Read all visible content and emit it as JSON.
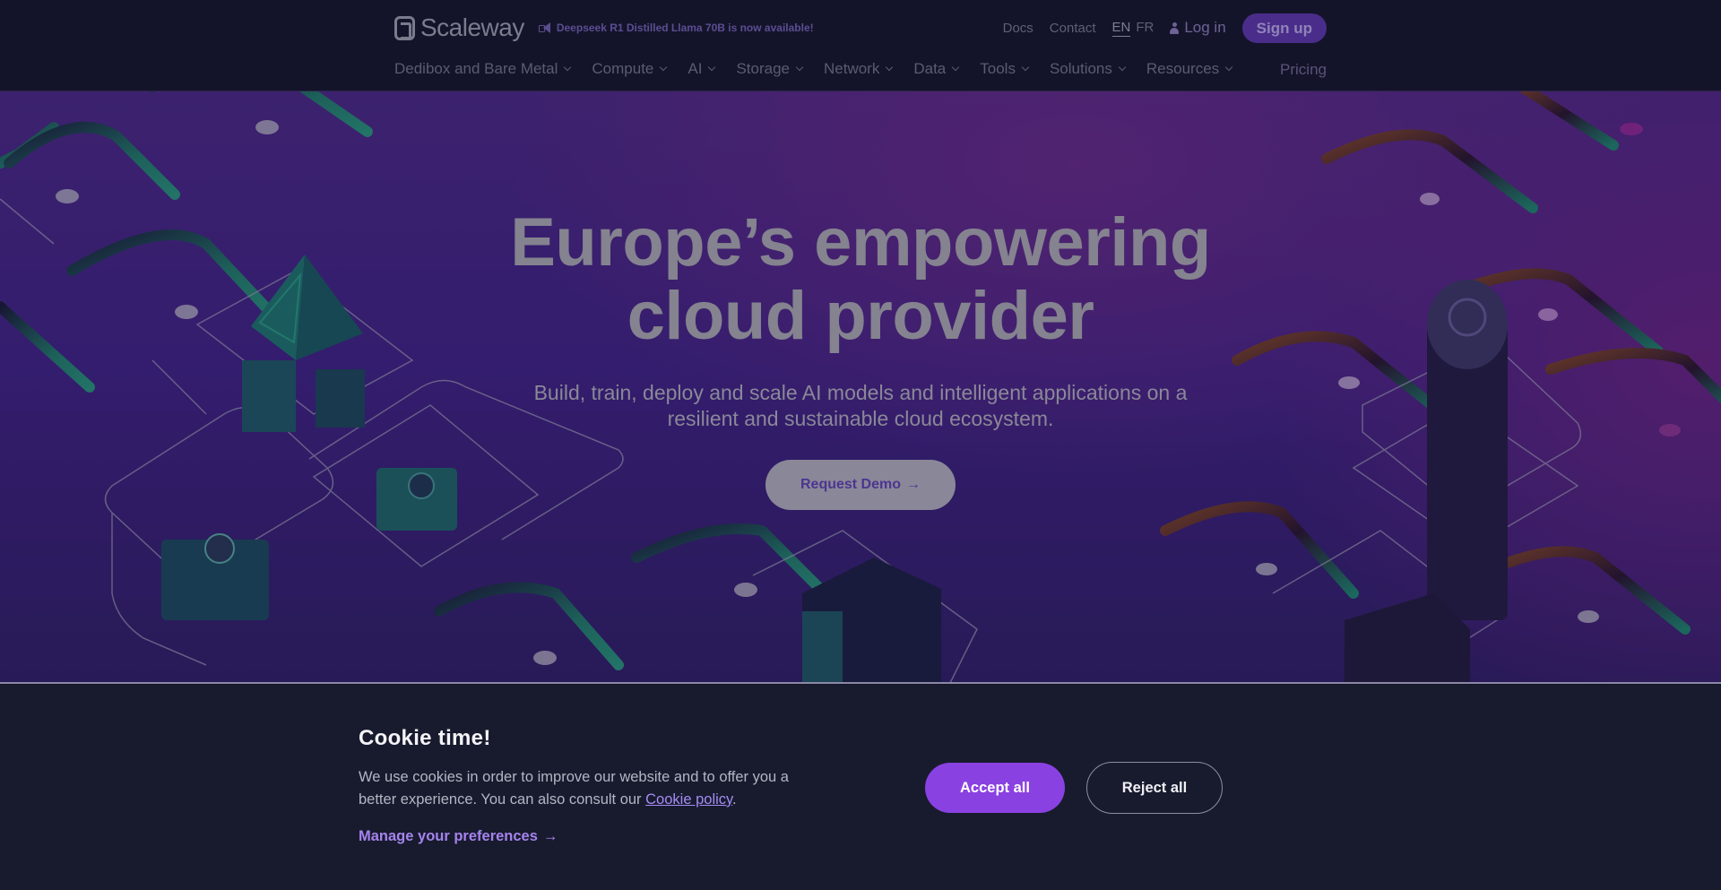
{
  "header": {
    "brand": "Scaleway",
    "announcement": "Deepseek R1 Distilled Llama 70B is now available!",
    "links": {
      "docs": "Docs",
      "contact": "Contact"
    },
    "languages": {
      "active": "EN",
      "other": "FR"
    },
    "login": "Log in",
    "signup": "Sign up",
    "nav": [
      {
        "label": "Dedibox and Bare Metal",
        "has_dropdown": true
      },
      {
        "label": "Compute",
        "has_dropdown": true
      },
      {
        "label": "AI",
        "has_dropdown": true
      },
      {
        "label": "Storage",
        "has_dropdown": true
      },
      {
        "label": "Network",
        "has_dropdown": true
      },
      {
        "label": "Data",
        "has_dropdown": true
      },
      {
        "label": "Tools",
        "has_dropdown": true
      },
      {
        "label": "Solutions",
        "has_dropdown": true
      },
      {
        "label": "Resources",
        "has_dropdown": true
      }
    ],
    "pricing": "Pricing"
  },
  "hero": {
    "title_line1": "Europe’s empowering",
    "title_line2": "cloud provider",
    "subtitle": "Build, train, deploy and scale AI models and intelligent applications on a resilient and sustainable cloud ecosystem.",
    "cta": "Request Demo",
    "cta_icon": "→"
  },
  "cookie_banner": {
    "title": "Cookie time!",
    "text_before_link": "We use cookies in order to improve our website and to offer you a better experience. You can also consult our ",
    "link": "Cookie policy",
    "text_after_link": ".",
    "manage": "Manage your preferences",
    "manage_icon": "→",
    "accept": "Accept all",
    "reject": "Reject all"
  },
  "colors": {
    "header_bg": "#13142a",
    "hero_purple": "#4d2a8a",
    "accent_purple": "#8a41e1",
    "cookie_bg": "#171b2d",
    "link_purple": "#a683ee"
  }
}
